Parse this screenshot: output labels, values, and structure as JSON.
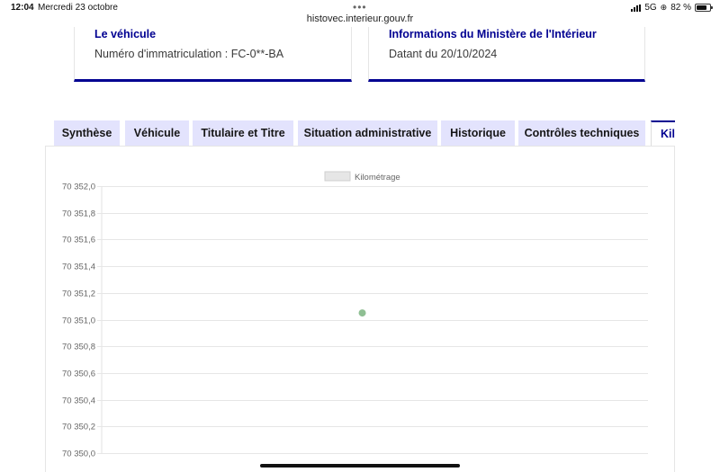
{
  "statusbar": {
    "time": "12:04",
    "date": "Mercredi 23 octobre",
    "network": "5G",
    "battery": "82 %",
    "battery_level": 0.82,
    "url": "histovec.interieur.gouv.fr"
  },
  "cards": {
    "vehicle_title": "Le véhicule",
    "vehicle_plate": "Numéro d'immatriculation : FC-0**-BA",
    "ministry_title": "Informations du Ministère de l'Intérieur",
    "ministry_date": "Datant du 20/10/2024"
  },
  "tabs": [
    {
      "label": "Synthèse",
      "active": false
    },
    {
      "label": "Véhicule",
      "active": false
    },
    {
      "label": "Titulaire et Titre",
      "active": false
    },
    {
      "label": "Situation administrative",
      "active": false
    },
    {
      "label": "Historique",
      "active": false
    },
    {
      "label": "Contrôles techniques",
      "active": false
    },
    {
      "label": "Kilo",
      "active": true
    }
  ],
  "colors": {
    "accent": "#000091",
    "tab_bg": "#e3e3fd",
    "point": "#8fbf93"
  },
  "chart_data": {
    "type": "line",
    "legend": "Kilométrage",
    "legend_position": "top",
    "ylim": [
      70350.0,
      70352.0
    ],
    "yticks": [
      "70 352,0",
      "70 351,8",
      "70 351,6",
      "70 351,4",
      "70 351,2",
      "70 351,0",
      "70 350,8",
      "70 350,6",
      "70 350,4",
      "70 350,2",
      "70 350,0"
    ],
    "ytick_values": [
      70352.0,
      70351.8,
      70351.6,
      70351.4,
      70351.2,
      70351.0,
      70350.8,
      70350.6,
      70350.4,
      70350.2,
      70350.0
    ],
    "grid": true,
    "series": [
      {
        "name": "Kilométrage",
        "points": [
          {
            "x_frac": 0.477,
            "y": 70351.05
          }
        ]
      }
    ]
  }
}
